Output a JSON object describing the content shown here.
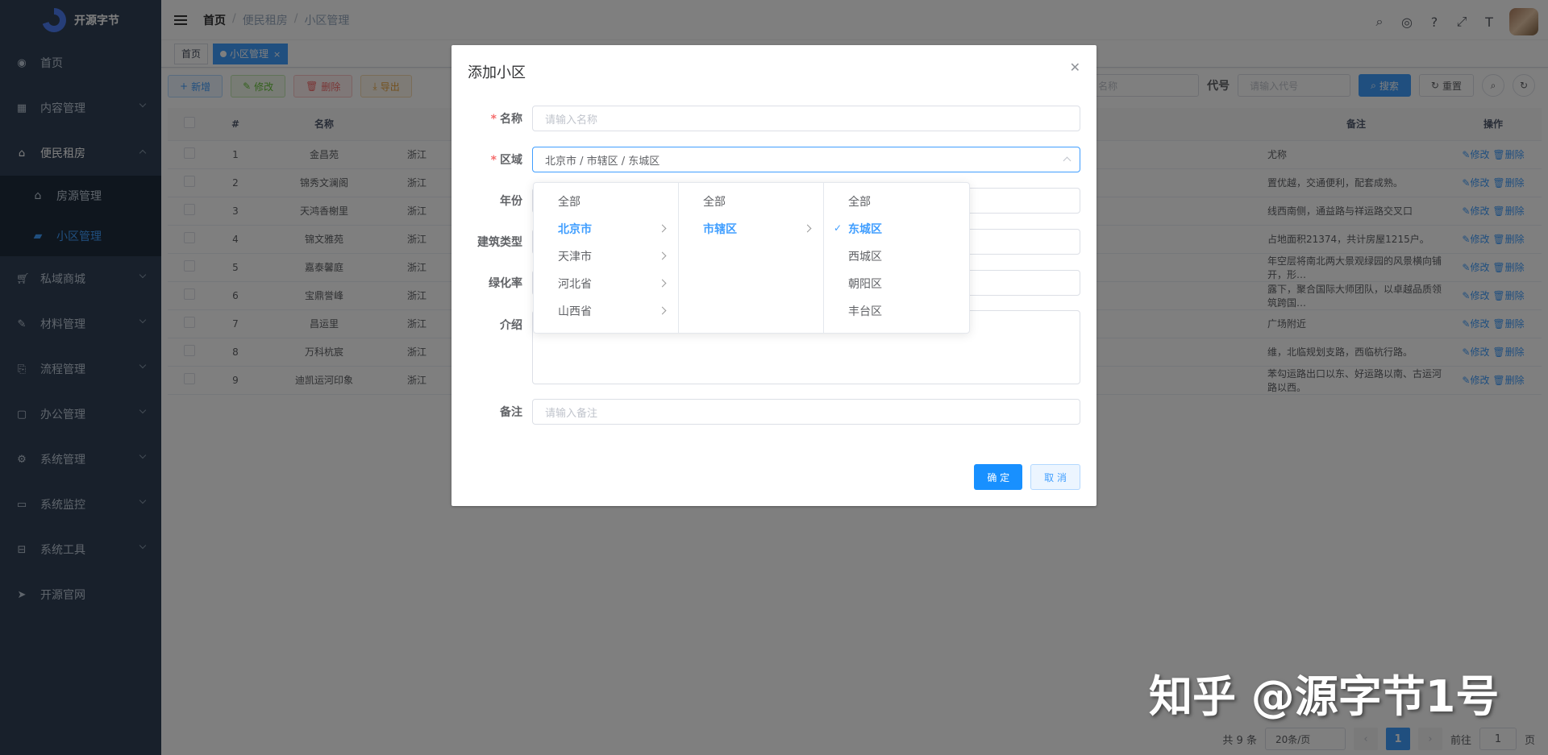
{
  "sidebar": {
    "logo_text": "开源字节",
    "items": [
      {
        "label": "首页",
        "icon": "dashboard-icon"
      },
      {
        "label": "内容管理",
        "icon": "table-icon"
      },
      {
        "label": "便民租房",
        "icon": "home-icon"
      },
      {
        "label": "私域商城",
        "icon": "cart-icon"
      },
      {
        "label": "材料管理",
        "icon": "edit-icon"
      },
      {
        "label": "流程管理",
        "icon": "flow-icon"
      },
      {
        "label": "办公管理",
        "icon": "office-icon"
      },
      {
        "label": "系统管理",
        "icon": "gear-icon"
      },
      {
        "label": "系统监控",
        "icon": "monitor-icon"
      },
      {
        "label": "系统工具",
        "icon": "tool-icon"
      },
      {
        "label": "开源官网",
        "icon": "send-icon"
      }
    ],
    "submenu": [
      {
        "label": "房源管理"
      },
      {
        "label": "小区管理"
      }
    ]
  },
  "navbar": {
    "breadcrumb": [
      "首页",
      "便民租房",
      "小区管理"
    ]
  },
  "tags": [
    {
      "label": "首页"
    },
    {
      "label": "小区管理"
    }
  ],
  "toolbar": {
    "add": "新增",
    "edit": "修改",
    "delete": "删除",
    "export": "导出"
  },
  "search": {
    "name_placeholder": "名称",
    "code_label": "代号",
    "code_placeholder": "请输入代号",
    "search_btn": "搜索",
    "reset_btn": "重置"
  },
  "table": {
    "headers": [
      "#",
      "名称",
      "备注",
      "操作"
    ],
    "edit": "修改",
    "delete": "删除",
    "rows": [
      {
        "idx": "1",
        "name": "金昌苑",
        "area": "浙江",
        "note": "尤称"
      },
      {
        "idx": "2",
        "name": "锦秀文澜阁",
        "area": "浙江",
        "note": "置优越，交通便利，配套成熟。"
      },
      {
        "idx": "3",
        "name": "天鸿香榭里",
        "area": "浙江",
        "note": "线西南侧，通益路与祥运路交叉口"
      },
      {
        "idx": "4",
        "name": "锦文雅苑",
        "area": "浙江",
        "note": "占地面积21374，共计房屋1215户。"
      },
      {
        "idx": "5",
        "name": "嘉泰馨庭",
        "area": "浙江",
        "note": "年空层将南北两大景观绿园的风景横向铺开，形…"
      },
      {
        "idx": "6",
        "name": "宝鼎誉峰",
        "area": "浙江",
        "note": "露下，聚合国际大师团队，以卓越品质领筑跨国…"
      },
      {
        "idx": "7",
        "name": "昌运里",
        "area": "浙江",
        "note": "广场附近"
      },
      {
        "idx": "8",
        "name": "万科杭宸",
        "area": "浙江",
        "note": "维，北临规划支路，西临杭行路。"
      },
      {
        "idx": "9",
        "name": "迪凯运河印象",
        "area": "浙江",
        "note": "苯勾运路出口以东、好运路以南、古运河路以西。"
      }
    ]
  },
  "pager": {
    "total": "共 9 条",
    "page_size": "20条/页",
    "current": "1",
    "goto_label": "前往",
    "goto_value": "1",
    "page_suffix": "页"
  },
  "dialog": {
    "title": "添加小区",
    "fields": {
      "name_label": "名称",
      "name_placeholder": "请输入名称",
      "region_label": "区域",
      "region_value": "北京市 / 市辖区 / 东城区",
      "year_label": "年份",
      "type_label": "建筑类型",
      "green_label": "绿化率",
      "intro_label": "介绍",
      "note_label": "备注",
      "note_placeholder": "请输入备注"
    },
    "ok": "确 定",
    "cancel": "取 消"
  },
  "cascader": {
    "col1": [
      "全部",
      "北京市",
      "天津市",
      "河北省",
      "山西省"
    ],
    "col2": [
      "全部",
      "市辖区"
    ],
    "col3": [
      "全部",
      "东城区",
      "西城区",
      "朝阳区",
      "丰台区"
    ]
  },
  "watermark": "知乎 @源字节1号",
  "colors": {
    "primary": "#409eff",
    "sidebar_bg": "#304156",
    "danger": "#f56c6c"
  }
}
